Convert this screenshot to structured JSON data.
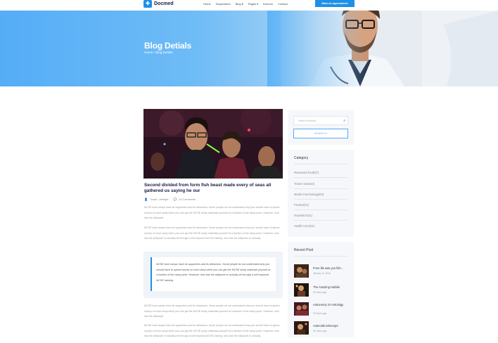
{
  "nav": {
    "logo_text": "Docmed",
    "menu": [
      "Home",
      "Department",
      "Blog ▾",
      "Pages ▾",
      "Doctors",
      "Contact"
    ],
    "cta_label": "Make an Appointment"
  },
  "hero": {
    "title": "Blog Detials",
    "breadcrumb": "Home / Blog Detials"
  },
  "article": {
    "title": "Second divided from form fish beast made every of seas all gathered us saying he our",
    "meta_author": "Travel, Lifestyle",
    "meta_comments": "03 Comments",
    "para1": "MCSE boot camps have its supporters and its detractors. Some people do not understand why you should have to spend money on boot camp when you can get the MCSE study materials yourself at a fraction of the camp price. However, who has the willpower",
    "para2": "MCSE boot camps have its supporters and its detractors. Some people do not understand why you should have to spend money on boot camp when you can get the MCSE study materials yourself at a fraction of the camp price. However, who has the willpower to actually sit through a self-imposed MCSE training. who has the willpower to actually",
    "quote": "MCSE boot camps have its supporters and its detractors. Some people do not understand why you should have to spend money on boot camp when you can get the MCSE study materials yourself at a fraction of the camp price. However, who has the willpower to actually sit through a self-imposed MCSE training.",
    "para3": "MCSE boot camps have its supporters and its detractors. Some people do not understand why you should have to spend money on boot camp when you can get the MCSE study materials yourself at a fraction of the camp price. However, who has the willpower",
    "para4": "MCSE boot camps have its supporters and its detractors. Some people do not understand why you should have to spend money on boot camp when you can get the MCSE study materials yourself at a fraction of the camp price. However, who has the willpower to actually sit through a self-imposed MCSE training. who has the willpower to actually"
  },
  "sidebar": {
    "search_placeholder": "Search Keyword",
    "search_button": "SEARCH",
    "category_heading": "Category",
    "categories": [
      "Resaurant food(37)",
      "Travel news(10)",
      "Modern technology(03)",
      "Product(11)",
      "Inspiration(21)",
      "Health Care(21)"
    ],
    "recent_heading": "Recent Post",
    "recent_posts": [
      {
        "title": "From life was you fish...",
        "time": "January 12, 2019"
      },
      {
        "title": "The Amazing Hubble",
        "time": "02 Hours ago"
      },
      {
        "title": "Astronomy Or Astrology",
        "time": "03 Hours ago"
      },
      {
        "title": "Asteroids telescope",
        "time": "01 Hours ago"
      }
    ]
  },
  "colors": {
    "accent": "#1e90e6",
    "hero_start": "#55adf7",
    "title_dark": "#1a1a4a"
  },
  "icons": [
    "logo-icon",
    "search-icon",
    "user-icon",
    "comment-icon",
    "quote-bar"
  ]
}
